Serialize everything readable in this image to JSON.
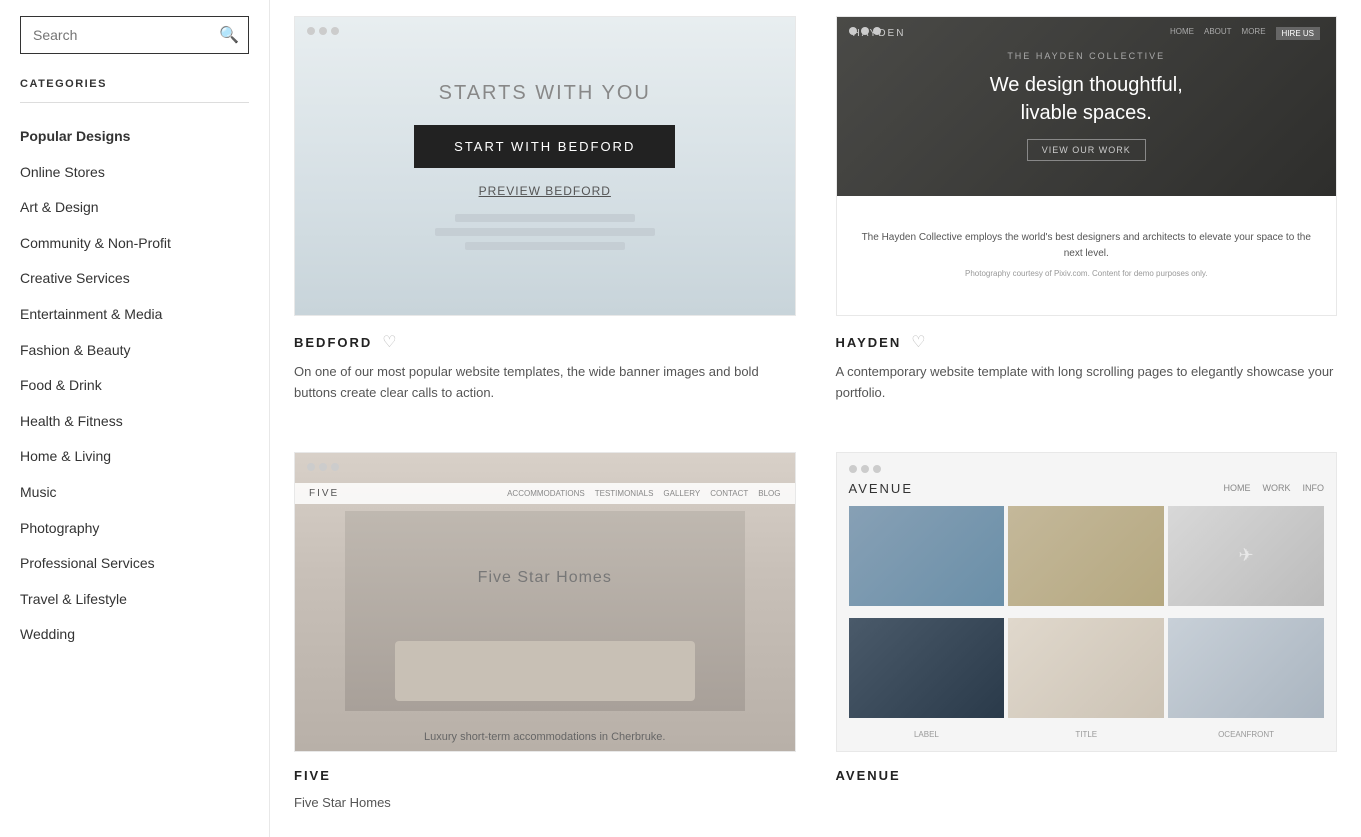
{
  "sidebar": {
    "search_placeholder": "Search",
    "categories_label": "CATEGORIES",
    "nav_items": [
      {
        "label": "Popular Designs",
        "active": false,
        "bold": true
      },
      {
        "label": "Online Stores",
        "active": false
      },
      {
        "label": "Art & Design",
        "active": false
      },
      {
        "label": "Community & Non-Profit",
        "active": false
      },
      {
        "label": "Creative Services",
        "active": false
      },
      {
        "label": "Entertainment & Media",
        "active": false
      },
      {
        "label": "Fashion & Beauty",
        "active": false
      },
      {
        "label": "Food & Drink",
        "active": false
      },
      {
        "label": "Health & Fitness",
        "active": false
      },
      {
        "label": "Home & Living",
        "active": false
      },
      {
        "label": "Music",
        "active": false
      },
      {
        "label": "Photography",
        "active": false
      },
      {
        "label": "Professional Services",
        "active": false
      },
      {
        "label": "Travel & Lifestyle",
        "active": false
      },
      {
        "label": "Wedding",
        "active": false
      }
    ]
  },
  "templates": [
    {
      "id": "bedford",
      "name": "BEDFORD",
      "description": "On one of our most popular website templates, the wide banner images and bold buttons create clear calls to action.",
      "preview_headline": "STARTS WITH YOU",
      "preview_btn": "START WITH BEDFORD",
      "preview_link": "PREVIEW BEDFORD"
    },
    {
      "id": "hayden",
      "name": "HAYDEN",
      "description": "A contemporary website template with long scrolling pages to elegantly showcase your portfolio.",
      "hayden_brand": "HAYDEN",
      "hayden_subtitle": "THE HAYDEN COLLECTIVE",
      "hayden_title": "We design thoughtful,\nlivable spaces.",
      "hayden_btn": "VIEW OUR WORK",
      "hayden_body": "The Hayden Collective employs the world's best designers and architects to elevate your space to the next level.",
      "hayden_caption": "Photography courtesy of Pixiv.com. Content for demo purposes only."
    },
    {
      "id": "five",
      "name": "FIVE",
      "description": "Five Star Homes",
      "preview_text": "Five Star Homes",
      "preview_caption": "Luxury short-term accommodations in Cherbruke."
    },
    {
      "id": "avenue",
      "name": "AVENUE",
      "description": ""
    }
  ],
  "icons": {
    "search": "🔍",
    "heart": "♡"
  }
}
